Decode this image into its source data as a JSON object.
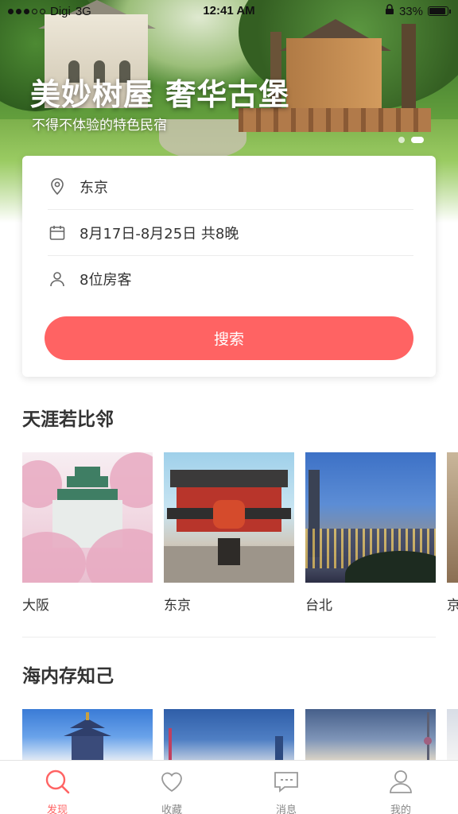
{
  "status_bar": {
    "carrier": "Digi",
    "network": "3G",
    "time": "12:41 AM",
    "battery": "33%"
  },
  "hero": {
    "title": "美妙树屋 奢华古堡",
    "subtitle": "不得不体验的特色民宿",
    "carousel_pages": 2,
    "carousel_active": 2
  },
  "search_card": {
    "destination": "东京",
    "dates": "8月17日-8月25日 共8晚",
    "guests": "8位房客",
    "search_label": "搜索"
  },
  "section_neighbors": {
    "title": "天涯若比邻",
    "cities": [
      {
        "name": "大阪",
        "image": "osaka-castle-cherry-blossoms"
      },
      {
        "name": "东京",
        "image": "asakusa-kaminarimon-temple"
      },
      {
        "name": "台北",
        "image": "taipei-101-skyline"
      },
      {
        "name": "京",
        "image": "kyoto-partial"
      }
    ]
  },
  "section_domestic": {
    "title": "海内存知己",
    "cities": [
      {
        "image": "temple-of-heaven"
      },
      {
        "image": "city-skyline-blue"
      },
      {
        "image": "tv-tower-skyline"
      }
    ]
  },
  "tab_bar": {
    "tabs": [
      {
        "label": "发现",
        "icon": "search-icon",
        "active": true
      },
      {
        "label": "收藏",
        "icon": "heart-icon",
        "active": false
      },
      {
        "label": "消息",
        "icon": "message-icon",
        "active": false
      },
      {
        "label": "我的",
        "icon": "user-icon",
        "active": false
      }
    ]
  },
  "colors": {
    "accent": "#ff6363",
    "text": "#333333",
    "inactive": "#888888"
  }
}
